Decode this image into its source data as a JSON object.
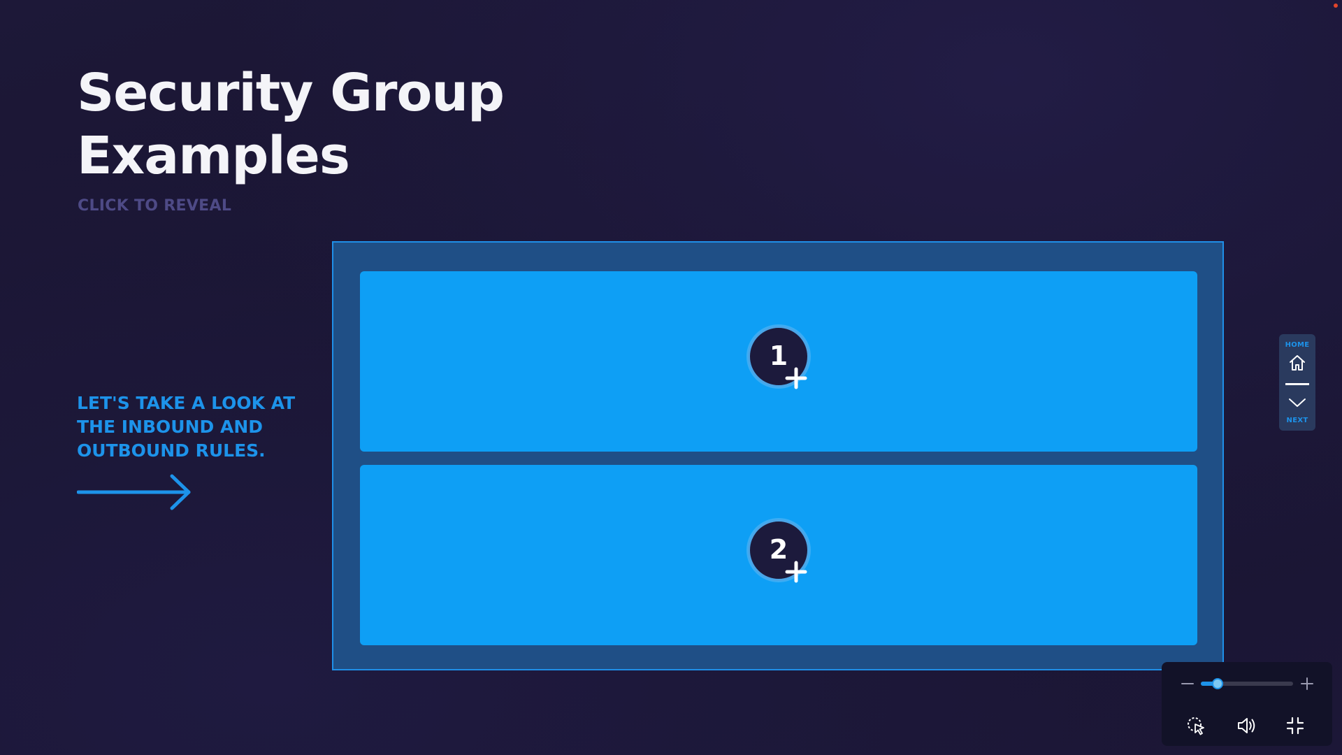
{
  "slide": {
    "title": "Security Group Examples",
    "subtitle": "CLICK TO REVEAL",
    "lead_text": "LET'S TAKE A LOOK AT THE INBOUND AND OUTBOUND RULES."
  },
  "cards": [
    {
      "number": "1"
    },
    {
      "number": "2"
    }
  ],
  "side_nav": {
    "home_label": "HOME",
    "next_label": "NEXT"
  },
  "player_controls": {
    "zoom_level": 0.18
  },
  "colors": {
    "accent_blue": "#1d93ea",
    "card_blue": "#0e9ff5",
    "panel_blue": "#1f4f86",
    "background": "#1a1634",
    "muted_text": "#4e4a86",
    "notification_dot": "#e2452b"
  },
  "icons": {
    "arrow": "right-arrow-icon",
    "hotspot": "plus-icon",
    "home": "home-icon",
    "next": "chevron-down-icon",
    "zoom_out": "minus-icon",
    "zoom_in": "plus-icon",
    "cursor": "cursor-highlight-icon",
    "volume": "volume-icon",
    "exit_fullscreen": "exit-fullscreen-icon"
  }
}
